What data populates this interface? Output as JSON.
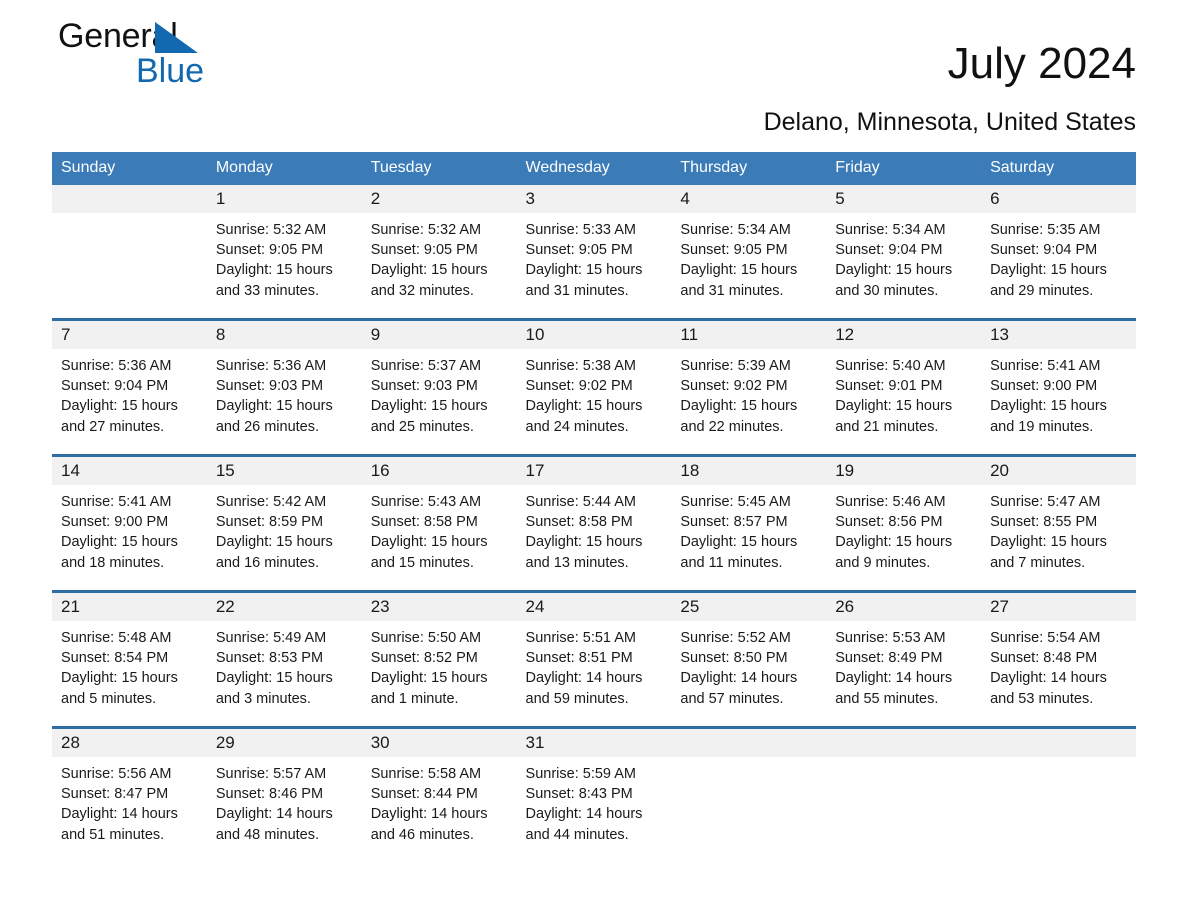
{
  "brand": {
    "name_part1": "General",
    "name_part2": "Blue",
    "triangle_color": "#1269b0"
  },
  "header": {
    "month_title": "July 2024",
    "location": "Delano, Minnesota, United States"
  },
  "theme": {
    "header_blue": "#3b7cb8",
    "row_divider_blue": "#2e6da4",
    "daynum_band": "#f1f1f1"
  },
  "calendar": {
    "weekday_headers": [
      "Sunday",
      "Monday",
      "Tuesday",
      "Wednesday",
      "Thursday",
      "Friday",
      "Saturday"
    ],
    "weeks": [
      [
        {
          "day": "",
          "empty": true,
          "sunrise": "",
          "sunset": "",
          "daylight_line1": "",
          "daylight_line2": ""
        },
        {
          "day": "1",
          "sunrise": "Sunrise: 5:32 AM",
          "sunset": "Sunset: 9:05 PM",
          "daylight_line1": "Daylight: 15 hours",
          "daylight_line2": "and 33 minutes."
        },
        {
          "day": "2",
          "sunrise": "Sunrise: 5:32 AM",
          "sunset": "Sunset: 9:05 PM",
          "daylight_line1": "Daylight: 15 hours",
          "daylight_line2": "and 32 minutes."
        },
        {
          "day": "3",
          "sunrise": "Sunrise: 5:33 AM",
          "sunset": "Sunset: 9:05 PM",
          "daylight_line1": "Daylight: 15 hours",
          "daylight_line2": "and 31 minutes."
        },
        {
          "day": "4",
          "sunrise": "Sunrise: 5:34 AM",
          "sunset": "Sunset: 9:05 PM",
          "daylight_line1": "Daylight: 15 hours",
          "daylight_line2": "and 31 minutes."
        },
        {
          "day": "5",
          "sunrise": "Sunrise: 5:34 AM",
          "sunset": "Sunset: 9:04 PM",
          "daylight_line1": "Daylight: 15 hours",
          "daylight_line2": "and 30 minutes."
        },
        {
          "day": "6",
          "sunrise": "Sunrise: 5:35 AM",
          "sunset": "Sunset: 9:04 PM",
          "daylight_line1": "Daylight: 15 hours",
          "daylight_line2": "and 29 minutes."
        }
      ],
      [
        {
          "day": "7",
          "sunrise": "Sunrise: 5:36 AM",
          "sunset": "Sunset: 9:04 PM",
          "daylight_line1": "Daylight: 15 hours",
          "daylight_line2": "and 27 minutes."
        },
        {
          "day": "8",
          "sunrise": "Sunrise: 5:36 AM",
          "sunset": "Sunset: 9:03 PM",
          "daylight_line1": "Daylight: 15 hours",
          "daylight_line2": "and 26 minutes."
        },
        {
          "day": "9",
          "sunrise": "Sunrise: 5:37 AM",
          "sunset": "Sunset: 9:03 PM",
          "daylight_line1": "Daylight: 15 hours",
          "daylight_line2": "and 25 minutes."
        },
        {
          "day": "10",
          "sunrise": "Sunrise: 5:38 AM",
          "sunset": "Sunset: 9:02 PM",
          "daylight_line1": "Daylight: 15 hours",
          "daylight_line2": "and 24 minutes."
        },
        {
          "day": "11",
          "sunrise": "Sunrise: 5:39 AM",
          "sunset": "Sunset: 9:02 PM",
          "daylight_line1": "Daylight: 15 hours",
          "daylight_line2": "and 22 minutes."
        },
        {
          "day": "12",
          "sunrise": "Sunrise: 5:40 AM",
          "sunset": "Sunset: 9:01 PM",
          "daylight_line1": "Daylight: 15 hours",
          "daylight_line2": "and 21 minutes."
        },
        {
          "day": "13",
          "sunrise": "Sunrise: 5:41 AM",
          "sunset": "Sunset: 9:00 PM",
          "daylight_line1": "Daylight: 15 hours",
          "daylight_line2": "and 19 minutes."
        }
      ],
      [
        {
          "day": "14",
          "sunrise": "Sunrise: 5:41 AM",
          "sunset": "Sunset: 9:00 PM",
          "daylight_line1": "Daylight: 15 hours",
          "daylight_line2": "and 18 minutes."
        },
        {
          "day": "15",
          "sunrise": "Sunrise: 5:42 AM",
          "sunset": "Sunset: 8:59 PM",
          "daylight_line1": "Daylight: 15 hours",
          "daylight_line2": "and 16 minutes."
        },
        {
          "day": "16",
          "sunrise": "Sunrise: 5:43 AM",
          "sunset": "Sunset: 8:58 PM",
          "daylight_line1": "Daylight: 15 hours",
          "daylight_line2": "and 15 minutes."
        },
        {
          "day": "17",
          "sunrise": "Sunrise: 5:44 AM",
          "sunset": "Sunset: 8:58 PM",
          "daylight_line1": "Daylight: 15 hours",
          "daylight_line2": "and 13 minutes."
        },
        {
          "day": "18",
          "sunrise": "Sunrise: 5:45 AM",
          "sunset": "Sunset: 8:57 PM",
          "daylight_line1": "Daylight: 15 hours",
          "daylight_line2": "and 11 minutes."
        },
        {
          "day": "19",
          "sunrise": "Sunrise: 5:46 AM",
          "sunset": "Sunset: 8:56 PM",
          "daylight_line1": "Daylight: 15 hours",
          "daylight_line2": "and 9 minutes."
        },
        {
          "day": "20",
          "sunrise": "Sunrise: 5:47 AM",
          "sunset": "Sunset: 8:55 PM",
          "daylight_line1": "Daylight: 15 hours",
          "daylight_line2": "and 7 minutes."
        }
      ],
      [
        {
          "day": "21",
          "sunrise": "Sunrise: 5:48 AM",
          "sunset": "Sunset: 8:54 PM",
          "daylight_line1": "Daylight: 15 hours",
          "daylight_line2": "and 5 minutes."
        },
        {
          "day": "22",
          "sunrise": "Sunrise: 5:49 AM",
          "sunset": "Sunset: 8:53 PM",
          "daylight_line1": "Daylight: 15 hours",
          "daylight_line2": "and 3 minutes."
        },
        {
          "day": "23",
          "sunrise": "Sunrise: 5:50 AM",
          "sunset": "Sunset: 8:52 PM",
          "daylight_line1": "Daylight: 15 hours",
          "daylight_line2": "and 1 minute."
        },
        {
          "day": "24",
          "sunrise": "Sunrise: 5:51 AM",
          "sunset": "Sunset: 8:51 PM",
          "daylight_line1": "Daylight: 14 hours",
          "daylight_line2": "and 59 minutes."
        },
        {
          "day": "25",
          "sunrise": "Sunrise: 5:52 AM",
          "sunset": "Sunset: 8:50 PM",
          "daylight_line1": "Daylight: 14 hours",
          "daylight_line2": "and 57 minutes."
        },
        {
          "day": "26",
          "sunrise": "Sunrise: 5:53 AM",
          "sunset": "Sunset: 8:49 PM",
          "daylight_line1": "Daylight: 14 hours",
          "daylight_line2": "and 55 minutes."
        },
        {
          "day": "27",
          "sunrise": "Sunrise: 5:54 AM",
          "sunset": "Sunset: 8:48 PM",
          "daylight_line1": "Daylight: 14 hours",
          "daylight_line2": "and 53 minutes."
        }
      ],
      [
        {
          "day": "28",
          "sunrise": "Sunrise: 5:56 AM",
          "sunset": "Sunset: 8:47 PM",
          "daylight_line1": "Daylight: 14 hours",
          "daylight_line2": "and 51 minutes."
        },
        {
          "day": "29",
          "sunrise": "Sunrise: 5:57 AM",
          "sunset": "Sunset: 8:46 PM",
          "daylight_line1": "Daylight: 14 hours",
          "daylight_line2": "and 48 minutes."
        },
        {
          "day": "30",
          "sunrise": "Sunrise: 5:58 AM",
          "sunset": "Sunset: 8:44 PM",
          "daylight_line1": "Daylight: 14 hours",
          "daylight_line2": "and 46 minutes."
        },
        {
          "day": "31",
          "sunrise": "Sunrise: 5:59 AM",
          "sunset": "Sunset: 8:43 PM",
          "daylight_line1": "Daylight: 14 hours",
          "daylight_line2": "and 44 minutes."
        },
        {
          "day": "",
          "empty": true,
          "sunrise": "",
          "sunset": "",
          "daylight_line1": "",
          "daylight_line2": ""
        },
        {
          "day": "",
          "empty": true,
          "sunrise": "",
          "sunset": "",
          "daylight_line1": "",
          "daylight_line2": ""
        },
        {
          "day": "",
          "empty": true,
          "sunrise": "",
          "sunset": "",
          "daylight_line1": "",
          "daylight_line2": ""
        }
      ]
    ]
  }
}
